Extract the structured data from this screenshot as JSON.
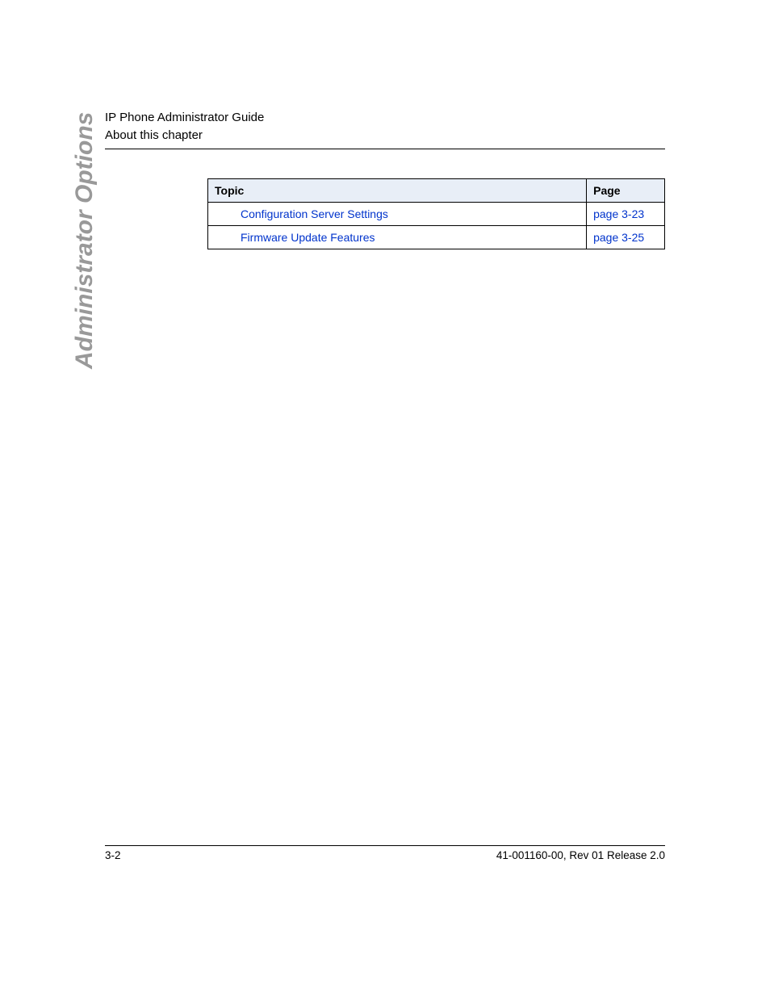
{
  "header": {
    "line1": "IP Phone Administrator Guide",
    "line2": "About this chapter"
  },
  "side_tab": "Administrator Options",
  "table": {
    "headers": {
      "topic": "Topic",
      "page": "Page"
    },
    "rows": [
      {
        "topic": "Configuration Server Settings",
        "page": "page 3-23"
      },
      {
        "topic": "Firmware Update Features",
        "page": "page 3-25"
      }
    ]
  },
  "footer": {
    "left": "3-2",
    "right": "41-001160-00, Rev 01  Release 2.0"
  }
}
